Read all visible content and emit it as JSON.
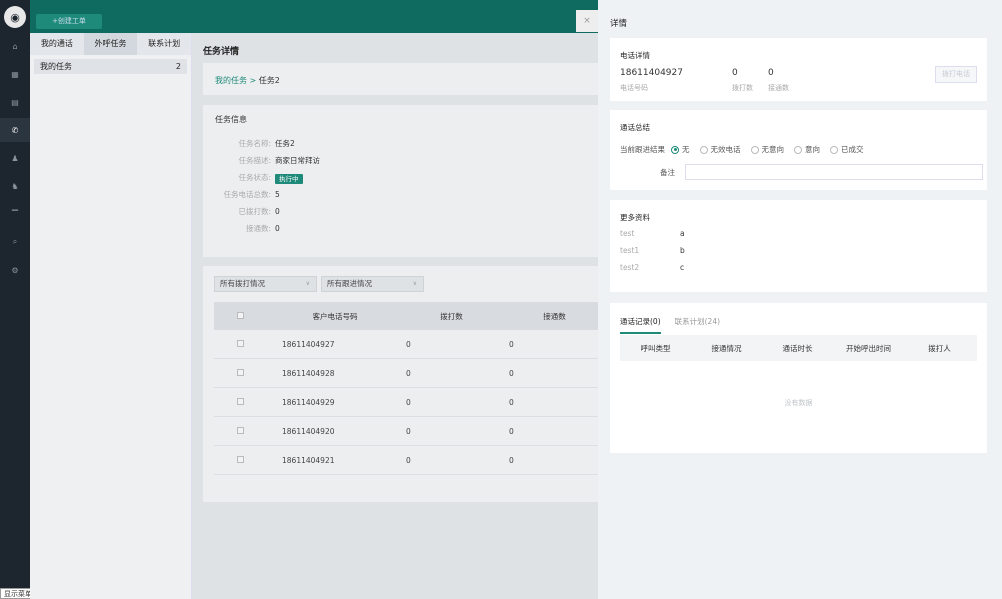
{
  "rail": {
    "footer_label": "显示菜单"
  },
  "topbar": {
    "new_ticket": "+创建工单"
  },
  "subside": {
    "tabs": [
      "我的通话",
      "外呼任务",
      "联系计划"
    ],
    "item_label": "我的任务",
    "item_count": "2"
  },
  "main": {
    "title": "任务详情",
    "breadcrumb_root": "我的任务",
    "breadcrumb_sep": ">",
    "breadcrumb_current": "任务2",
    "info": {
      "heading": "任务信息",
      "rows": [
        {
          "k": "任务名称:",
          "v": "任务2"
        },
        {
          "k": "任务描述:",
          "v": "商家日常拜访"
        },
        {
          "k": "任务状态:",
          "v": "执行中"
        },
        {
          "k": "任务电话总数:",
          "v": "5"
        },
        {
          "k": "已拨打数:",
          "v": "0"
        },
        {
          "k": "接通数:",
          "v": "0"
        }
      ]
    },
    "filters": [
      "所有拨打情况",
      "所有跟进情况"
    ],
    "table": {
      "headers": [
        "客户电话号码",
        "拨打数",
        "接通数"
      ],
      "rows": [
        {
          "phone": "18611404927",
          "dial": "0",
          "connect": "0"
        },
        {
          "phone": "18611404928",
          "dial": "0",
          "connect": "0"
        },
        {
          "phone": "18611404929",
          "dial": "0",
          "connect": "0"
        },
        {
          "phone": "18611404920",
          "dial": "0",
          "connect": "0"
        },
        {
          "phone": "18611404921",
          "dial": "0",
          "connect": "0"
        }
      ]
    }
  },
  "drawer": {
    "close": "×",
    "title": "详情",
    "phone_detail": {
      "heading": "电话详情",
      "phone": "18611404927",
      "phone_label": "电话号码",
      "dial_value": "0",
      "dial_label": "拨打数",
      "connect_value": "0",
      "connect_label": "接通数",
      "call_button": "拨打电话"
    },
    "summary": {
      "heading": "通话总结",
      "result_label": "当前跟进结果",
      "options": [
        "无",
        "无效电话",
        "无意向",
        "意向",
        "已成交"
      ],
      "selected_index": 0,
      "remark_label": "备注",
      "remark_value": ""
    },
    "more": {
      "heading": "更多资料",
      "items": [
        {
          "k": "test",
          "v": "a"
        },
        {
          "k": "test1",
          "v": "b"
        },
        {
          "k": "test2",
          "v": "c"
        }
      ]
    },
    "records": {
      "tabs": [
        "通话记录(0)",
        "联系计划(24)"
      ],
      "headers": [
        "呼叫类型",
        "接通情况",
        "通话时长",
        "开始呼出时间",
        "拨打人"
      ],
      "empty": "没有数据"
    }
  }
}
